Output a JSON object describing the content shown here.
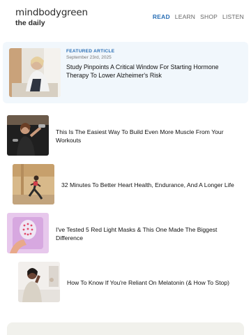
{
  "header": {
    "brand": "mindbodygreen",
    "subtitle": "the daily",
    "nav": [
      "READ",
      "LEARN",
      "SHOP",
      "LISTEN"
    ],
    "active_nav": "READ"
  },
  "featured": {
    "eyebrow": "FEATURED ARTICLE",
    "date": "September 23rd, 2025",
    "title": "Study Pinpoints A Critical Window For Starting Hormone Therapy To Lower Alzheimer's Risk"
  },
  "articles": [
    {
      "title": "This Is The Easiest Way To Build Even More Muscle From Your Workouts",
      "image": "woman-lifting-dumbbells"
    },
    {
      "title": "32 Minutes To Better Heart Health, Endurance, And A Longer Life",
      "image": "woman-running"
    },
    {
      "title": "I've Tested 5 Red Light Masks & This One Made The Biggest Difference",
      "image": "red-light-mask"
    },
    {
      "title": "How To Know If You're Reliant On Melatonin (& How To Stop)",
      "image": "woman-waking-up"
    }
  ],
  "colors": {
    "accent": "#2a6fb5",
    "featured_bg": "#f1f7fc",
    "footer_card_bg": "#f1f1ec"
  }
}
